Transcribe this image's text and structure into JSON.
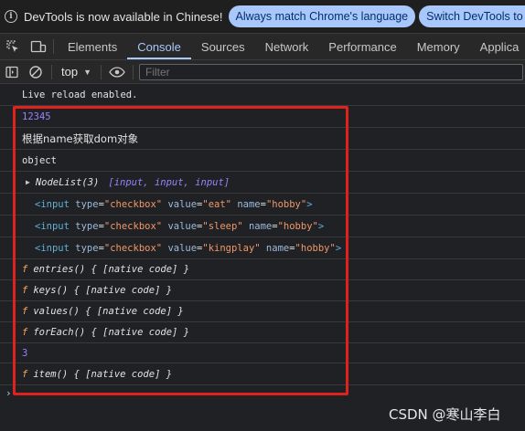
{
  "infobar": {
    "message": "DevTools is now available in Chinese!",
    "btn_match": "Always match Chrome's language",
    "btn_switch": "Switch DevTools to C"
  },
  "tabs": {
    "elements": "Elements",
    "console": "Console",
    "sources": "Sources",
    "network": "Network",
    "performance": "Performance",
    "memory": "Memory",
    "application": "Applica"
  },
  "toolbar": {
    "context": "top",
    "filter_placeholder": "Filter"
  },
  "console": {
    "live_reload": "Live reload enabled.",
    "number": "12345",
    "zh_text": "根据name获取dom对象",
    "object": "object",
    "nodelist": {
      "label": "NodeList(3)",
      "items": "[input, input, input]"
    },
    "inputs": [
      {
        "type": "\"checkbox\"",
        "value": "\"eat\"",
        "name": "\"hobby\""
      },
      {
        "type": "\"checkbox\"",
        "value": "\"sleep\"",
        "name": "\"hobby\""
      },
      {
        "type": "\"checkbox\"",
        "value": "\"kingplay\"",
        "name": "\"hobby\""
      }
    ],
    "funcs": {
      "entries": "entries() { [native code] }",
      "keys": "keys() { [native code] }",
      "values": "values() { [native code] }",
      "forEach": "forEach() { [native code] }",
      "item": "item() { [native code] }"
    },
    "length": "3",
    "f_symbol": "f",
    "prompt": "›"
  },
  "watermark": "CSDN @寒山李白",
  "colors": {
    "accent": "#a8c7fa",
    "highlight_box": "#e0221c"
  }
}
